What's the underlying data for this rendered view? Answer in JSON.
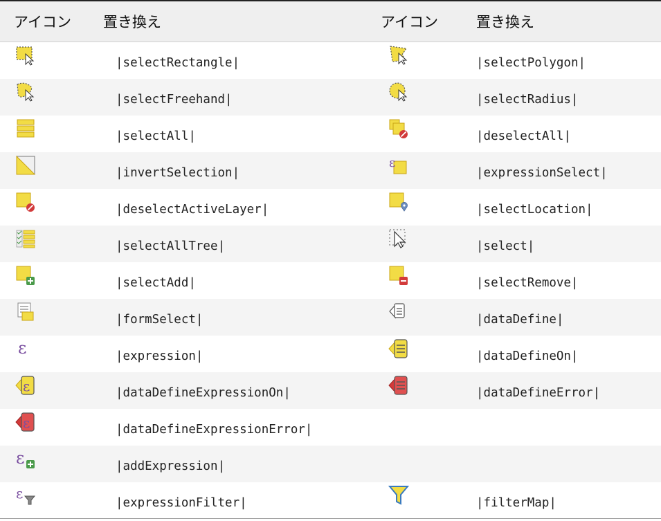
{
  "table": {
    "headers": [
      "アイコン",
      "置き換え",
      "アイコン",
      "置き換え"
    ],
    "rows": [
      {
        "left": {
          "icon": "select-rectangle-icon",
          "code": "|selectRectangle|"
        },
        "right": {
          "icon": "select-polygon-icon",
          "code": "|selectPolygon|"
        }
      },
      {
        "left": {
          "icon": "select-freehand-icon",
          "code": "|selectFreehand|"
        },
        "right": {
          "icon": "select-radius-icon",
          "code": "|selectRadius|"
        }
      },
      {
        "left": {
          "icon": "select-all-icon",
          "code": "|selectAll|"
        },
        "right": {
          "icon": "deselect-all-icon",
          "code": "|deselectAll|"
        }
      },
      {
        "left": {
          "icon": "invert-selection-icon",
          "code": "|invertSelection|"
        },
        "right": {
          "icon": "expression-select-icon",
          "code": "|expressionSelect|"
        }
      },
      {
        "left": {
          "icon": "deselect-active-layer-icon",
          "code": "|deselectActiveLayer|"
        },
        "right": {
          "icon": "select-location-icon",
          "code": "|selectLocation|"
        }
      },
      {
        "left": {
          "icon": "select-all-tree-icon",
          "code": "|selectAllTree|"
        },
        "right": {
          "icon": "select-icon",
          "code": "|select|"
        }
      },
      {
        "left": {
          "icon": "select-add-icon",
          "code": "|selectAdd|"
        },
        "right": {
          "icon": "select-remove-icon",
          "code": "|selectRemove|"
        }
      },
      {
        "left": {
          "icon": "form-select-icon",
          "code": "|formSelect|"
        },
        "right": {
          "icon": "data-define-icon",
          "code": "|dataDefine|"
        }
      },
      {
        "left": {
          "icon": "expression-icon",
          "code": "|expression|"
        },
        "right": {
          "icon": "data-define-on-icon",
          "code": "|dataDefineOn|"
        }
      },
      {
        "left": {
          "icon": "data-define-expression-on-icon",
          "code": "|dataDefineExpressionOn|"
        },
        "right": {
          "icon": "data-define-error-icon",
          "code": "|dataDefineError|"
        }
      },
      {
        "left": {
          "icon": "data-define-expression-error-icon",
          "code": "|dataDefineExpressionError|"
        },
        "right": {
          "icon": "",
          "code": ""
        }
      },
      {
        "left": {
          "icon": "add-expression-icon",
          "code": "|addExpression|"
        },
        "right": {
          "icon": "",
          "code": ""
        }
      },
      {
        "left": {
          "icon": "expression-filter-icon",
          "code": "|expressionFilter|"
        },
        "right": {
          "icon": "filter-map-icon",
          "code": "|filterMap|"
        }
      }
    ]
  },
  "colors": {
    "yellow": "#f2dc45",
    "yellow_dark": "#c9a515",
    "purple": "#7a4fa0",
    "red": "#d23a3a",
    "green": "#4a9a4a",
    "header_bg": "#efefef",
    "stripe_bg": "#f4f4f4"
  }
}
